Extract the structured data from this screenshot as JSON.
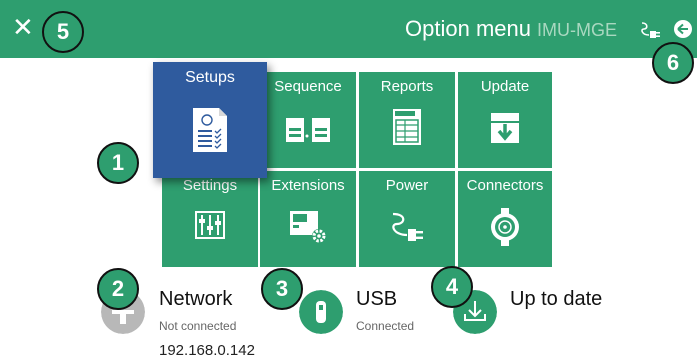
{
  "header": {
    "title": "Option menu",
    "device": "IMU-MGE",
    "close_icon": "close-icon",
    "plug_icon": "power-plug-icon",
    "back_icon": "back-arrow-icon"
  },
  "tiles": {
    "setups": "Setups",
    "sequence": "Sequence",
    "reports": "Reports",
    "update": "Update",
    "settings": "Settings",
    "extensions": "Extensions",
    "power": "Power",
    "connectors": "Connectors",
    "report_doc_text": "Report"
  },
  "status": {
    "network": {
      "title": "Network",
      "state": "Not connected",
      "ip": "192.168.0.142"
    },
    "usb": {
      "title": "USB",
      "state": "Connected"
    },
    "update": {
      "title": "Up to date"
    }
  },
  "badges": [
    "1",
    "2",
    "3",
    "4",
    "5",
    "6"
  ],
  "colors": {
    "primary": "#2e9e6f",
    "selected": "#2f5b9e",
    "inactive": "#b8b8b8"
  }
}
